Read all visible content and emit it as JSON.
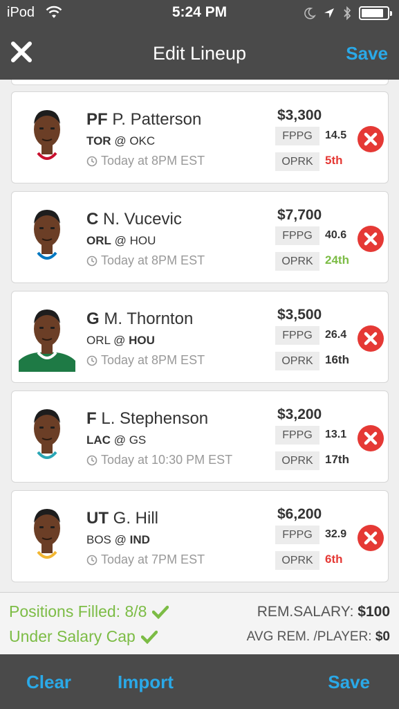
{
  "status_bar": {
    "carrier": "iPod",
    "time": "5:24 PM",
    "battery_level": 0.85
  },
  "nav": {
    "title": "Edit Lineup",
    "save_label": "Save",
    "close_icon": "close-icon"
  },
  "players": [
    {
      "position": "PF",
      "name": "P. Patterson",
      "away": "TOR",
      "at": "@",
      "home": "OKC",
      "bold_team": "away",
      "game_time": "Today at 8PM EST",
      "salary": "$3,300",
      "fppg_label": "FPPG",
      "fppg": "14.5",
      "oprk_label": "OPRK",
      "oprk": "5th",
      "oprk_color": "#e53935",
      "jersey": "#ffffff",
      "trim": "#c8102e"
    },
    {
      "position": "C",
      "name": "N. Vucevic",
      "away": "ORL",
      "at": "@",
      "home": "HOU",
      "bold_team": "away",
      "game_time": "Today at 8PM EST",
      "salary": "$7,700",
      "fppg_label": "FPPG",
      "fppg": "40.6",
      "oprk_label": "OPRK",
      "oprk": "24th",
      "oprk_color": "#7cbc45",
      "jersey": "#ffffff",
      "trim": "#0077c0"
    },
    {
      "position": "G",
      "name": "M. Thornton",
      "away": "ORL",
      "at": "@",
      "home": "HOU",
      "bold_team": "home",
      "game_time": "Today at 8PM EST",
      "salary": "$3,500",
      "fppg_label": "FPPG",
      "fppg": "26.4",
      "oprk_label": "OPRK",
      "oprk": "16th",
      "oprk_color": "#333333",
      "jersey": "#1e7a45",
      "trim": "#ffffff"
    },
    {
      "position": "F",
      "name": "L. Stephenson",
      "away": "LAC",
      "at": "@",
      "home": "GS",
      "bold_team": "away",
      "game_time": "Today at 10:30 PM EST",
      "salary": "$3,200",
      "fppg_label": "FPPG",
      "fppg": "13.1",
      "oprk_label": "OPRK",
      "oprk": "17th",
      "oprk_color": "#333333",
      "jersey": "#ffffff",
      "trim": "#2aa6b5"
    },
    {
      "position": "UT",
      "name": "G. Hill",
      "away": "BOS",
      "at": "@",
      "home": "IND",
      "bold_team": "home",
      "game_time": "Today at 7PM EST",
      "salary": "$6,200",
      "fppg_label": "FPPG",
      "fppg": "32.9",
      "oprk_label": "OPRK",
      "oprk": "6th",
      "oprk_color": "#e53935",
      "jersey": "#ffffff",
      "trim": "#f2b632"
    }
  ],
  "summary": {
    "positions_filled": "Positions Filled: 8/8",
    "under_cap": "Under Salary Cap",
    "rem_salary_label": "REM.SALARY:",
    "rem_salary_value": "$100",
    "avg_rem_label": "AVG REM. /PLAYER:",
    "avg_rem_value": "$0"
  },
  "toolbar": {
    "clear_label": "Clear",
    "import_label": "Import",
    "save_label": "Save"
  },
  "colors": {
    "accent": "#2aa9e8",
    "good": "#7cbc45",
    "bad": "#e53935",
    "bar": "#4a4a4a"
  }
}
